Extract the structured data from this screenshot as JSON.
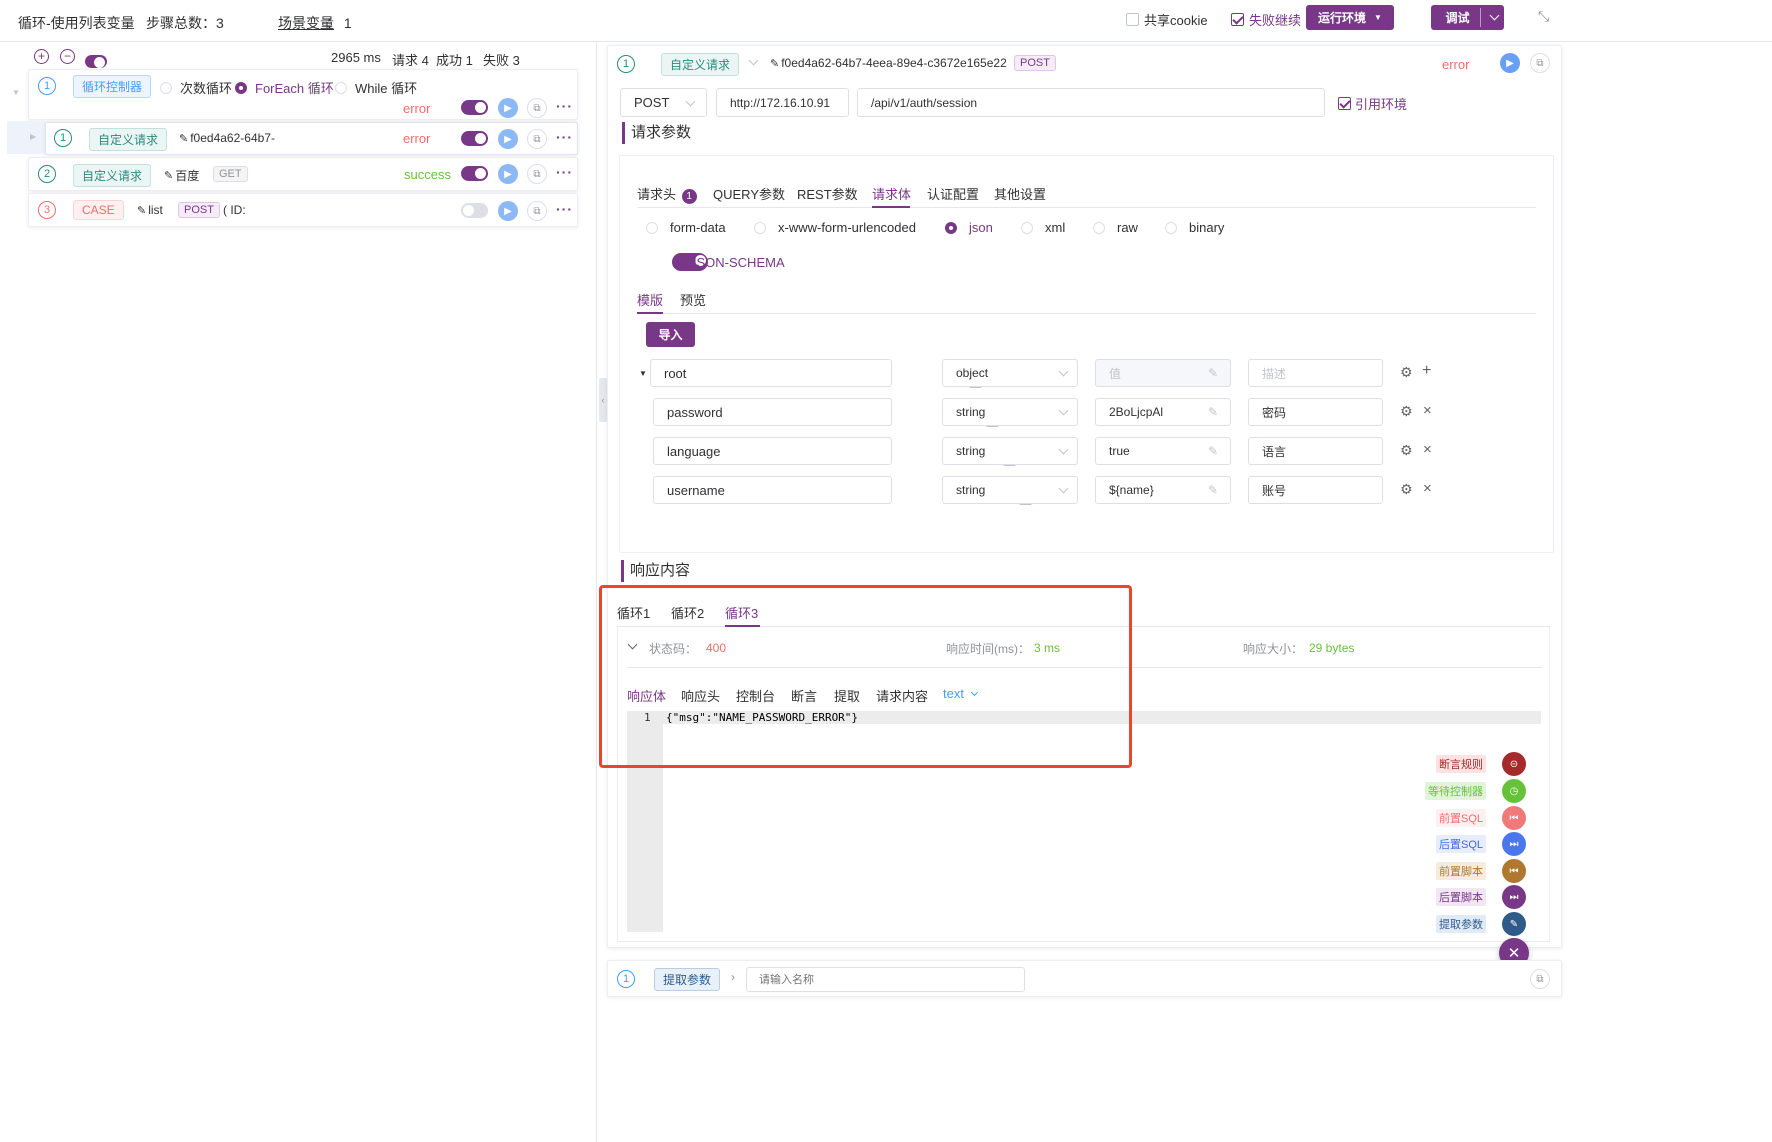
{
  "topbar": {
    "scenario_name": "循环-使用列表变量",
    "steps_label": "步骤总数：3",
    "scene_var_label": "场景变量",
    "scene_var_count": "：  1",
    "share_cookie": "共享cookie",
    "fail_continue": "失败继续",
    "run_env": "运行环境",
    "debug": "调试"
  },
  "left": {
    "summary": {
      "time": "2965 ms",
      "requests": "请求 4",
      "success": "成功 1",
      "fail": "失败 3"
    },
    "loop": {
      "index": "1",
      "tag": "循环控制器",
      "options": [
        "次数循环",
        "ForEach 循环",
        "While 循环"
      ],
      "status": "error"
    },
    "steps": [
      {
        "index": "1",
        "tag": "自定义请求",
        "name": "f0ed4a62-64b7-",
        "method": "",
        "status": "error"
      },
      {
        "index": "2",
        "tag": "自定义请求",
        "name": "百度",
        "method": "GET",
        "status": "success"
      },
      {
        "index": "3",
        "tag": "CASE",
        "name": "list",
        "method": "POST",
        "extra": "( ID:",
        "status": ""
      }
    ]
  },
  "right": {
    "header": {
      "index": "1",
      "tag": "自定义请求",
      "name": "f0ed4a62-64b7-4eea-89e4-c3672e165e22",
      "method": "POST",
      "status": "error"
    },
    "request_line": {
      "method": "POST",
      "host": "http://172.16.10.91",
      "path": "/api/v1/auth/session",
      "use_env": "引用环境"
    },
    "req_params_title": "请求参数",
    "req_tabs": [
      {
        "label": "请求头",
        "badge": "1"
      },
      {
        "label": "QUERY参数"
      },
      {
        "label": "REST参数"
      },
      {
        "label": "请求体"
      },
      {
        "label": "认证配置"
      },
      {
        "label": "其他设置"
      }
    ],
    "body_types": [
      "form-data",
      "x-www-form-urlencoded",
      "json",
      "xml",
      "raw",
      "binary"
    ],
    "json_schema": "JSON-SCHEMA",
    "mode_tabs": [
      "模版",
      "预览"
    ],
    "import_btn": "导入",
    "schema_rows": [
      {
        "name": "root",
        "type": "object",
        "value": "值",
        "desc": "描述",
        "action": "+"
      },
      {
        "name": "password",
        "type": "string",
        "value": "2BoLjcpAl",
        "desc": "密码",
        "action": "×"
      },
      {
        "name": "language",
        "type": "string",
        "value": "true",
        "desc": "语言",
        "action": "×"
      },
      {
        "name": "username",
        "type": "string",
        "value": "${name}",
        "desc": "账号",
        "action": "×"
      }
    ],
    "resp_title": "响应内容",
    "loop_tabs": [
      "循环1",
      "循环2",
      "循环3"
    ],
    "resp_meta": {
      "status_label": "状态码：",
      "status_val": "400",
      "time_label": "响应时间(ms)：",
      "time_val": "3 ms",
      "size_label": "响应大小：",
      "size_val": "29 bytes"
    },
    "resp_tabs": [
      "响应体",
      "响应头",
      "控制台",
      "断言",
      "提取",
      "请求内容",
      "text"
    ],
    "code_line_no": "1",
    "code_line": "{\"msg\":\"NAME_PASSWORD_ERROR\"}",
    "side_actions": [
      {
        "label": "断言规则",
        "color": "#a52a2a",
        "bg": "#fde2e2",
        "icon": "assert-icon"
      },
      {
        "label": "等待控制器",
        "color": "#67c23a",
        "bg": "#e1f3d8",
        "icon": "clock-icon"
      },
      {
        "label": "前置SQL",
        "color": "#f56c6c",
        "bg": "#fef0f0",
        "icon": "pre-sql-icon"
      },
      {
        "label": "后置SQL",
        "color": "#4168e6",
        "bg": "#e8edfc",
        "icon": "post-sql-icon"
      },
      {
        "label": "前置脚本",
        "color": "#b0772e",
        "bg": "#f7ecdc",
        "icon": "pre-script-icon"
      },
      {
        "label": "后置脚本",
        "color": "#783887",
        "bg": "#f2e5f4",
        "icon": "post-script-icon"
      },
      {
        "label": "提取参数",
        "color": "#2f5b8a",
        "bg": "#e1ebf5",
        "icon": "extract-icon"
      }
    ],
    "footer": {
      "index": "1",
      "tag": "提取参数",
      "placeholder": "请输入名称"
    }
  },
  "colors": {
    "accent": "#783887",
    "error": "#f56c6c",
    "success": "#67c23a",
    "highlight_box": "#e8472b"
  }
}
